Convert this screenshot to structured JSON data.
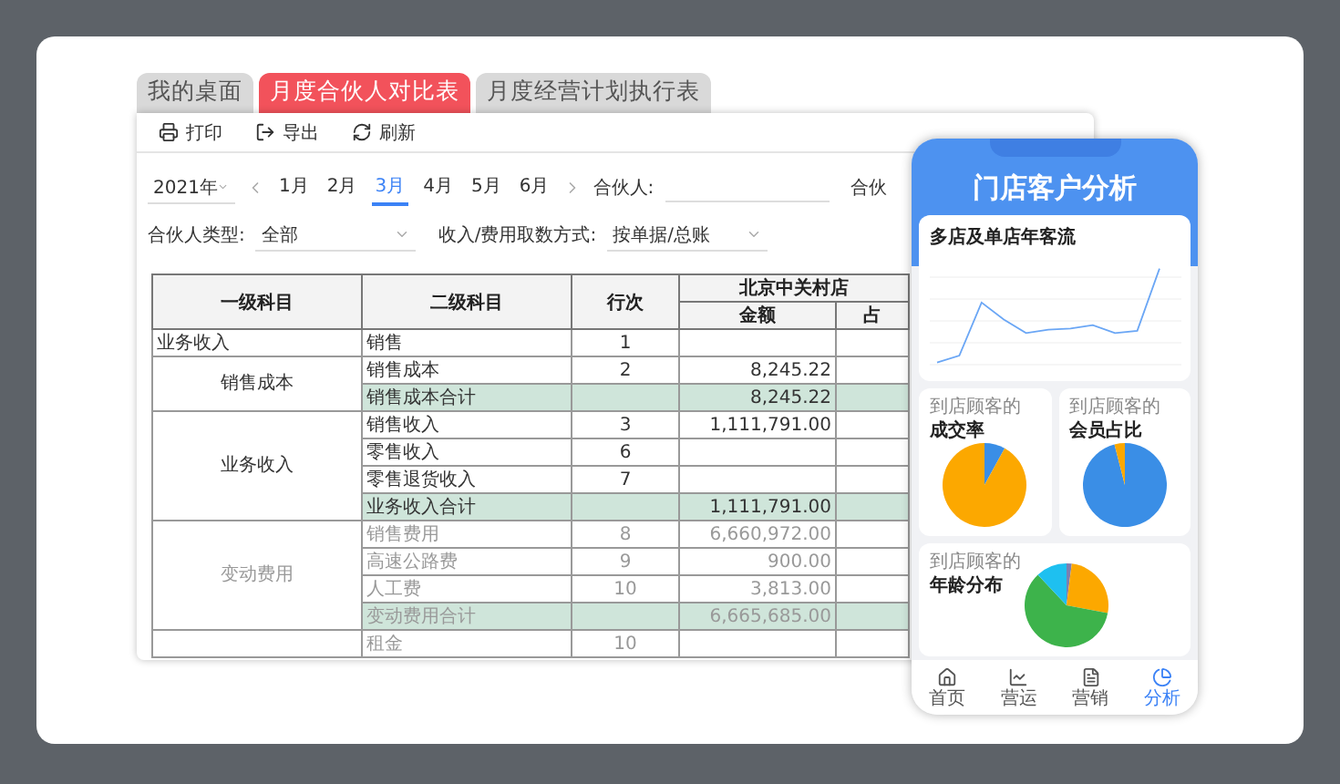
{
  "tabs": [
    {
      "label": "我的桌面",
      "selected": false
    },
    {
      "label": "月度合伙人对比表",
      "selected": true
    },
    {
      "label": "月度经营计划执行表",
      "selected": false
    }
  ],
  "toolbar": [
    {
      "kind": "print",
      "label": "打印"
    },
    {
      "kind": "export",
      "label": "导出"
    },
    {
      "kind": "refresh",
      "label": "刷新"
    }
  ],
  "filters": {
    "year": "2021年",
    "months": [
      {
        "label": "1月",
        "selected": false
      },
      {
        "label": "2月",
        "selected": false
      },
      {
        "label": "3月",
        "selected": true
      },
      {
        "label": "4月",
        "selected": false
      },
      {
        "label": "5月",
        "selected": false
      },
      {
        "label": "6月",
        "selected": false
      }
    ],
    "partner_label": "合伙人:",
    "partner_label_2": "合伙",
    "type_label": "合伙人类型:",
    "type_value": "全部",
    "method_label": "收入/费用取数方式:",
    "method_value": "按单据/总账"
  },
  "table": {
    "columns": [
      "一级科目",
      "二级科目",
      "行次"
    ],
    "store": "北京中关村店",
    "store_columns": [
      "金额",
      "占"
    ],
    "groups": [
      {
        "name": "业务收入",
        "kind": "plain",
        "rows": [
          {
            "kind": "item",
            "name": "销售",
            "line": "1",
            "amount": ""
          }
        ]
      },
      {
        "name": "销售成本",
        "kind": "merged",
        "rows": [
          {
            "kind": "item",
            "name": "销售成本",
            "line": "2",
            "amount": "8,245.22"
          },
          {
            "kind": "subtotal",
            "name": "销售成本合计",
            "line": "",
            "amount": "8,245.22"
          }
        ]
      },
      {
        "name": "业务收入",
        "kind": "merged",
        "rows": [
          {
            "kind": "item",
            "name": "销售收入",
            "line": "3",
            "amount": "1,111,791.00"
          },
          {
            "kind": "item",
            "name": "零售收入",
            "line": "6",
            "amount": ""
          },
          {
            "kind": "item",
            "name": "零售退货收入",
            "line": "7",
            "amount": ""
          },
          {
            "kind": "subtotal",
            "name": "业务收入合计",
            "line": "",
            "amount": "1,111,791.00"
          }
        ]
      },
      {
        "name": "变动费用",
        "kind": "merged",
        "rows": [
          {
            "kind": "item",
            "name": "销售费用",
            "line": "8",
            "amount": "6,660,972.00"
          },
          {
            "kind": "item",
            "name": "高速公路费",
            "line": "9",
            "amount": "900.00"
          },
          {
            "kind": "item",
            "name": "人工费",
            "line": "10",
            "amount": "3,813.00"
          },
          {
            "kind": "subtotal",
            "name": "变动费用合计",
            "line": "",
            "amount": "6,665,685.00"
          }
        ]
      },
      {
        "kind": "merged",
        "rows": [
          {
            "kind": "item",
            "name": "租金",
            "line": "10",
            "amount": ""
          }
        ]
      }
    ]
  },
  "phone": {
    "title": "门店客户分析",
    "line_card": {
      "title": "多店及单店年客流"
    },
    "cards": [
      {
        "kind": "pie",
        "subtitle": "到店顾客的",
        "title": "成交率"
      },
      {
        "kind": "pie",
        "subtitle": "到店顾客的",
        "title": "会员占比"
      }
    ],
    "age_card": {
      "subtitle": "到店顾客的",
      "title": "年龄分布"
    },
    "nav": [
      {
        "kind": "home",
        "label": "首页",
        "selected": false
      },
      {
        "kind": "chart",
        "label": "营运",
        "selected": false
      },
      {
        "kind": "doc",
        "label": "营销",
        "selected": false
      },
      {
        "kind": "pie",
        "label": "分析",
        "selected": true
      }
    ]
  }
}
